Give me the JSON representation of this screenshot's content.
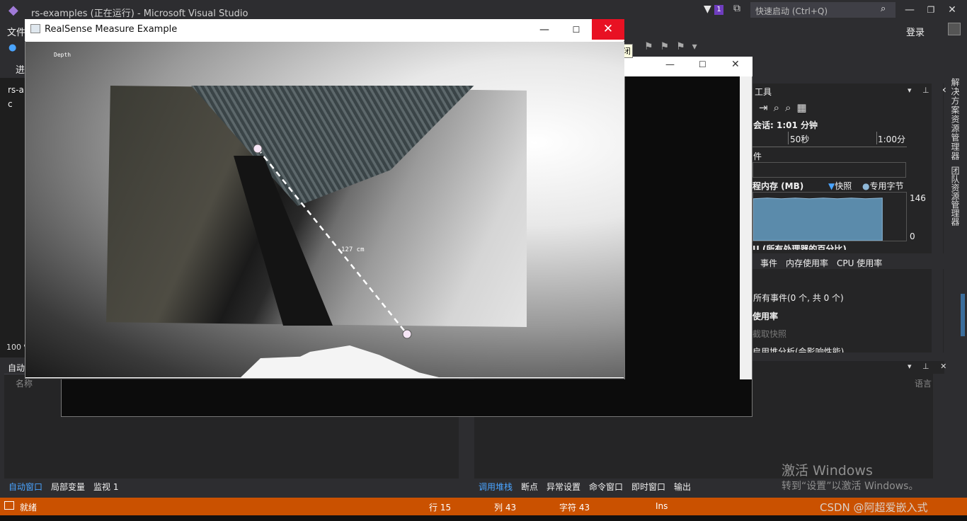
{
  "vs": {
    "title": "rs-examples (正在运行) - Microsoft Visual Studio",
    "notification_count": "1",
    "quick_launch_placeholder": "快速启动 (Ctrl+Q)",
    "menu_file": "文件",
    "login": "登录",
    "left_fragments": [
      "进",
      "rs-a",
      "c",
      "100 %"
    ],
    "auto_window_header": "自动",
    "auto_col_name": "名称",
    "col_language": "语言",
    "side_tabs": [
      "解决方案资源管理器",
      "团队资源管理器"
    ]
  },
  "diagnostics": {
    "title": "工具",
    "session": "会话: 1:01 分钟",
    "tick_50s": "50秒",
    "tick_1m": "1:00分",
    "events_label": "件",
    "memory_label": "程内存 (MB)",
    "legend_snapshot": "快照",
    "legend_private": "专用字节",
    "memory_max": "146",
    "memory_min": "0",
    "cpu_label": "U (所有处理器的百分比)",
    "tabs": [
      "事件",
      "内存使用率",
      "CPU 使用率"
    ],
    "all_events": "所有事件(0 个, 共 0 个)",
    "usage_label": "使用率",
    "take_snapshot": "截取快照",
    "heap_fragment": "启用堆分析(会影响性能)"
  },
  "rs_window": {
    "title": "RealSense Measure Example",
    "close_tooltip": "关闭",
    "depth_label": "Depth",
    "measurement": "127 cm"
  },
  "bottom_left_tabs": [
    "自动窗口",
    "局部变量",
    "监视 1"
  ],
  "bottom_right_tabs": [
    "调用堆栈",
    "断点",
    "异常设置",
    "命令窗口",
    "即时窗口",
    "输出"
  ],
  "status": {
    "ready": "就绪",
    "line": "行 15",
    "col": "列 43",
    "char": "字符 43",
    "ins": "Ins"
  },
  "watermark": {
    "line1": "激活 Windows",
    "line2": "转到“设置”以激活 Windows。",
    "csdn": "CSDN @阿超爱嵌入式"
  },
  "colors": {
    "status_bar": "#ca5100",
    "close_red": "#e81123",
    "accent_blue": "#4aa4ff"
  }
}
